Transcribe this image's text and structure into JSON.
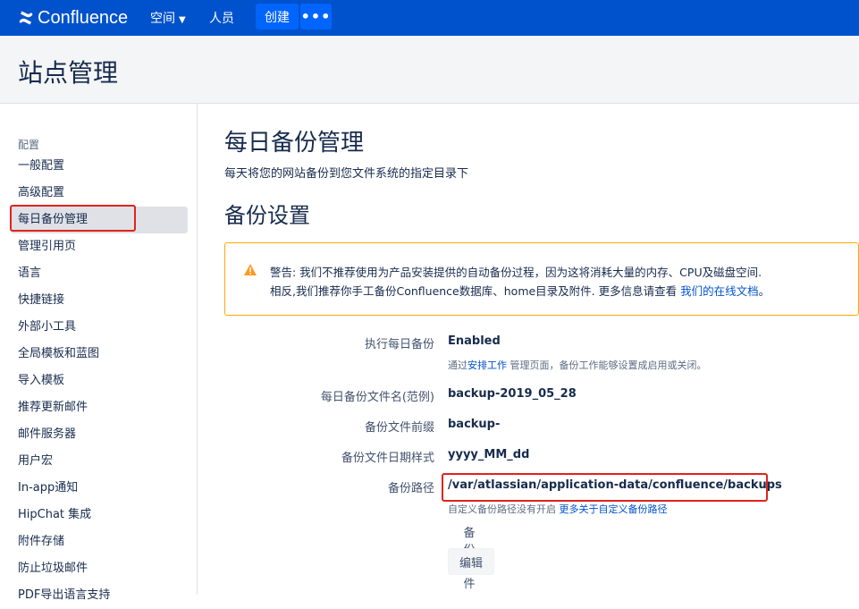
{
  "topbar": {
    "logo_text": "Confluence",
    "spaces_label": "空间",
    "people_label": "人员",
    "create_label": "创建",
    "more_label": "•••"
  },
  "page_title": "站点管理",
  "sidebar": {
    "section_title": "配置",
    "items": [
      {
        "label": "一般配置"
      },
      {
        "label": "高级配置"
      },
      {
        "label": "每日备份管理"
      },
      {
        "label": "管理引用页"
      },
      {
        "label": "语言"
      },
      {
        "label": "快捷链接"
      },
      {
        "label": "外部小工具"
      },
      {
        "label": "全局模板和蓝图"
      },
      {
        "label": "导入模板"
      },
      {
        "label": "推荐更新邮件"
      },
      {
        "label": "邮件服务器"
      },
      {
        "label": "用户宏"
      },
      {
        "label": "In-app通知"
      },
      {
        "label": "HipChat 集成"
      },
      {
        "label": "附件存储"
      },
      {
        "label": "防止垃圾邮件"
      },
      {
        "label": "PDF导出语言支持"
      }
    ]
  },
  "main": {
    "title": "每日备份管理",
    "description": "每天将您的网站备份到您文件系统的指定目录下",
    "settings_title": "备份设置",
    "warning": {
      "line1": "警告: 我们不推荐使用为产品安装提供的自动备份过程，因为这将消耗大量的内存、CPU及磁盘空间.",
      "line2_prefix": "相反,我们推荐你手工备份Confluence数据库、home目录及附件. 更多信息请查看 ",
      "line2_link": "我们的在线文档",
      "line2_suffix": "。"
    },
    "fields": {
      "enabled_label": "执行每日备份",
      "enabled_value": "Enabled",
      "enabled_help_prefix": "通过",
      "enabled_help_link": "安排工作",
      "enabled_help_suffix": " 管理页面，备份工作能够设置成启用或关闭。",
      "filename_label": "每日备份文件名(范例)",
      "filename_value": "backup-2019_05_28",
      "prefix_label": "备份文件前缀",
      "prefix_value": "backup-",
      "date_format_label": "备份文件日期样式",
      "date_format_value": "yyyy_MM_dd",
      "path_label": "备份路径",
      "path_value": "/var/atlassian/application-data/confluence/backups",
      "path_help_prefix": "自定义备份路径没有开启 ",
      "path_help_link": "更多关于自定义备份路径",
      "attachments_label": "备份附件",
      "attachments_checked": true,
      "edit_label": "编辑"
    }
  },
  "colors": {
    "brand_blue": "#0052cc",
    "highlight_red": "#e0231c",
    "warning_amber": "#ffab00"
  }
}
